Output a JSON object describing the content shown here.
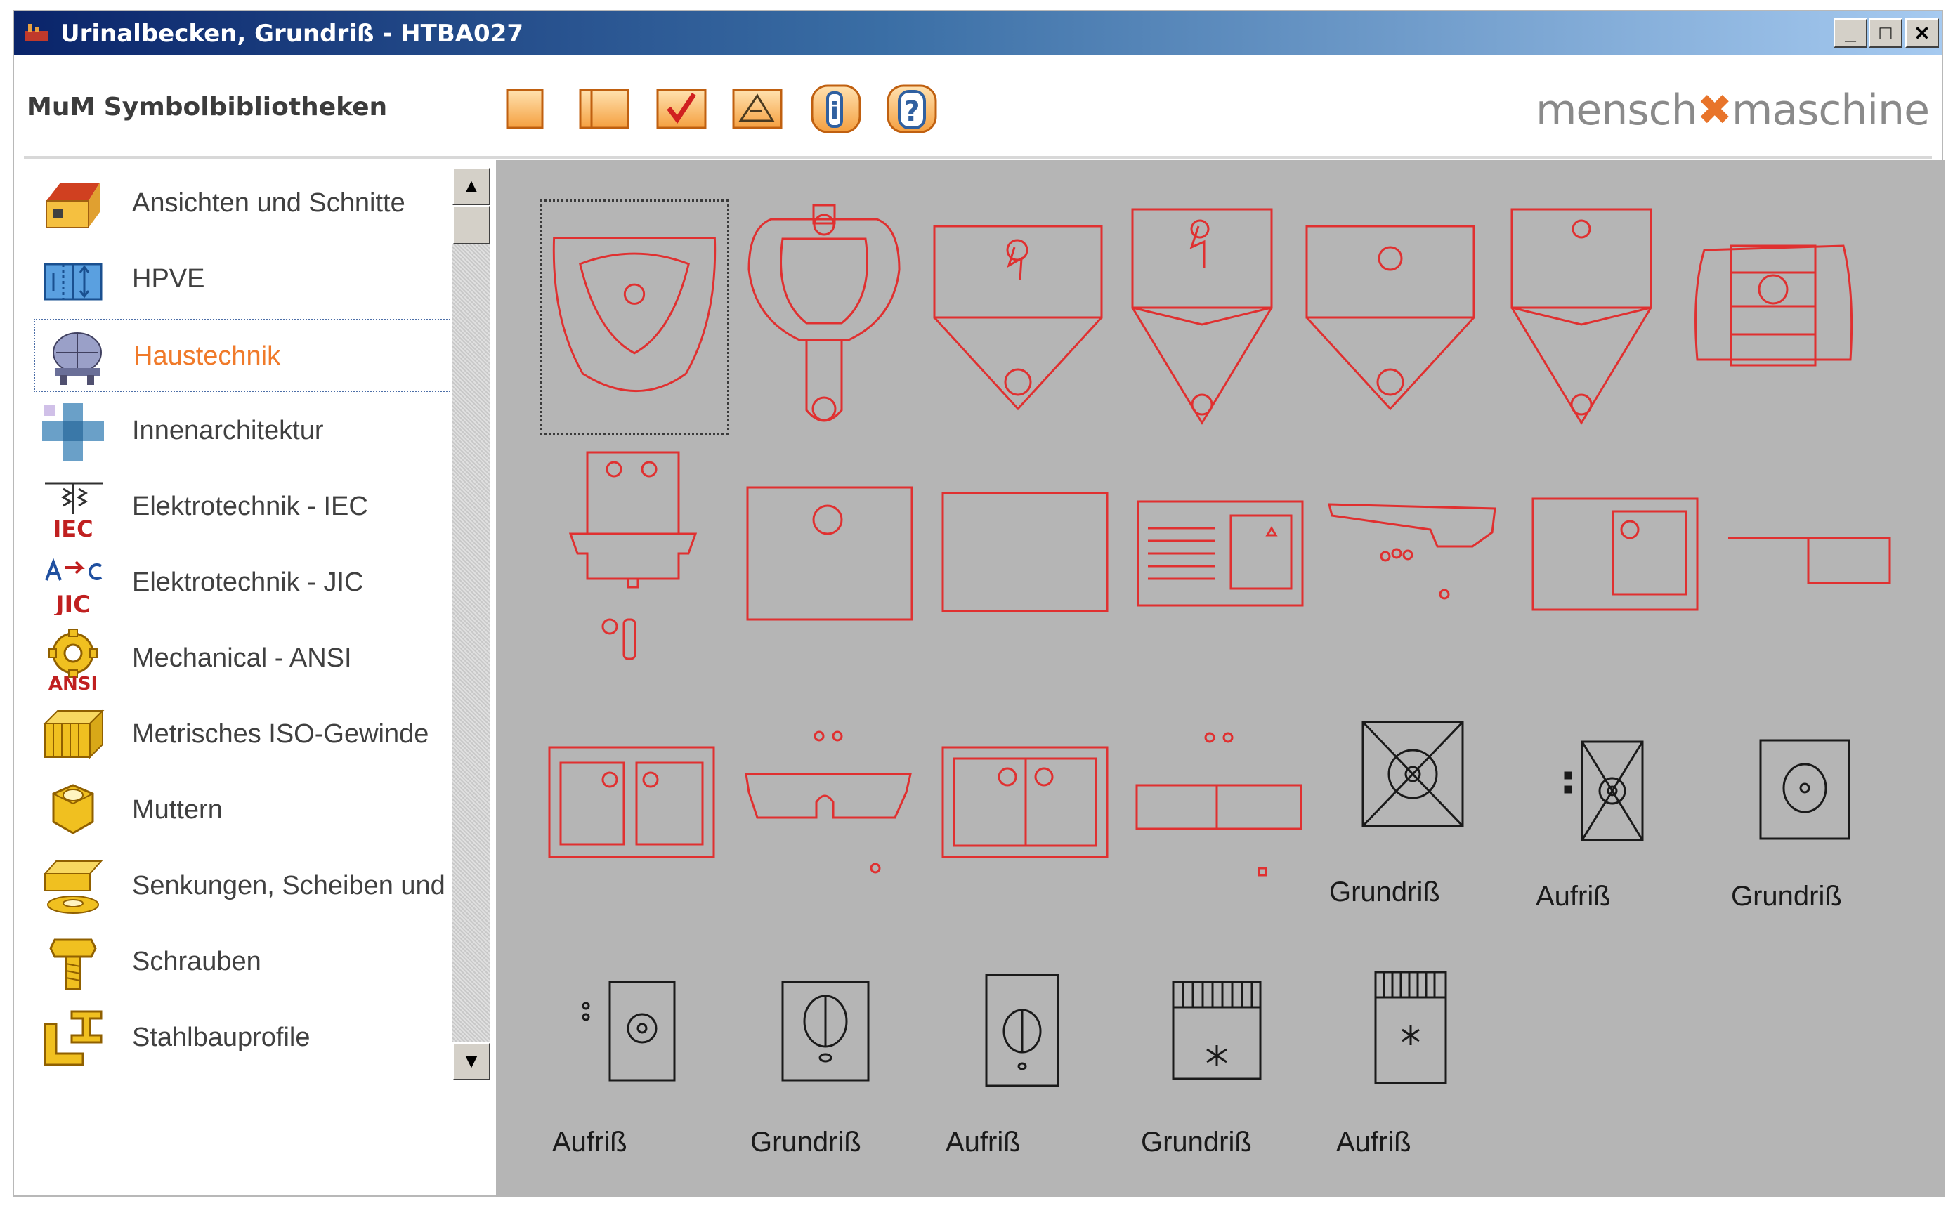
{
  "window": {
    "title": "Urinalbecken, Grundriß - HTBA027",
    "controls": {
      "minimize": "_",
      "maximize": "□",
      "close": "✕"
    }
  },
  "header": {
    "app_name": "MuM Symbolbibliotheken",
    "logo_left": "mensch",
    "logo_mark": "✖",
    "logo_right": "maschine",
    "tools": [
      "new-page-icon",
      "open-book-icon",
      "checkmark-icon",
      "edit-properties-icon",
      "info-icon",
      "help-icon"
    ]
  },
  "sidebar": {
    "scroll_up": "▲",
    "scroll_down": "▼",
    "items": [
      {
        "label": "Ansichten und Schnitte",
        "icon": "house-icon"
      },
      {
        "label": "HPVE",
        "icon": "hpve-icon"
      },
      {
        "label": "Haustechnik",
        "icon": "haustechnik-icon",
        "selected": true
      },
      {
        "label": "Innenarchitektur",
        "icon": "cross-icon"
      },
      {
        "label": "Elektrotechnik - IEC",
        "icon": "iec-icon",
        "badge": "IEC"
      },
      {
        "label": "Elektrotechnik - JIC",
        "icon": "jic-icon",
        "badge": "JIC"
      },
      {
        "label": "Mechanical - ANSI",
        "icon": "gear-icon",
        "badge": "ANSI"
      },
      {
        "label": "Metrisches ISO-Gewinde",
        "icon": "thread-icon"
      },
      {
        "label": "Muttern",
        "icon": "nut-icon"
      },
      {
        "label": "Senkungen, Scheiben und Du",
        "icon": "washer-icon"
      },
      {
        "label": "Schrauben",
        "icon": "screw-icon"
      },
      {
        "label": "Stahlbauprofile",
        "icon": "steel-profile-icon"
      }
    ]
  },
  "symbols": {
    "labels": {
      "r3_5": "Grundriß",
      "r3_6": "Aufriß",
      "r3_7": "Grundriß",
      "r4_1": "Aufriß",
      "r4_2": "Grundriß",
      "r4_3": "Aufriß",
      "r4_4": "Grundriß",
      "r4_5": "Aufriß"
    }
  },
  "colors": {
    "symbol_red": "#e03030",
    "panel_gray": "#b5b5b5",
    "accent_orange": "#f07a2a"
  }
}
